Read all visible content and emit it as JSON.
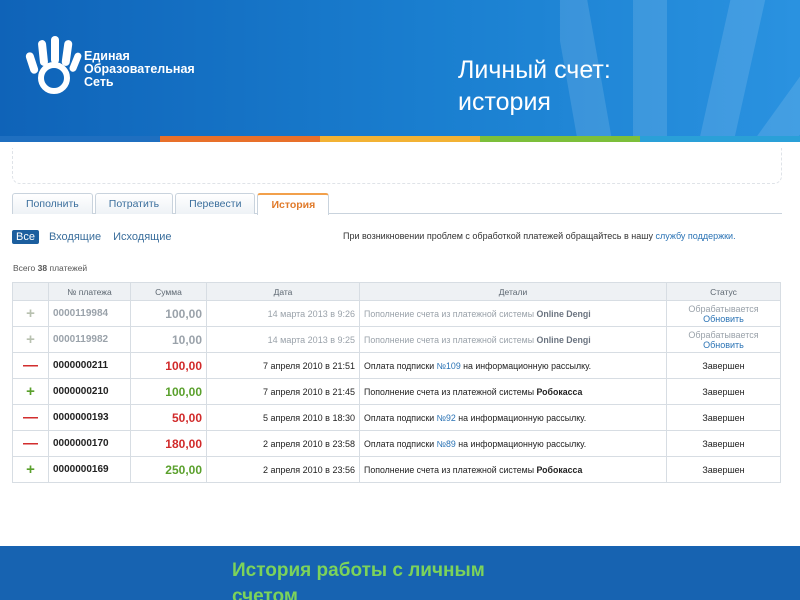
{
  "brand": {
    "line1": "Единая",
    "line2": "Образовательная",
    "line3": "Сеть"
  },
  "slide_title": {
    "line1": "Личный счет:",
    "line2": "история"
  },
  "tabs": [
    {
      "label": "Пополнить",
      "active": false
    },
    {
      "label": "Потратить",
      "active": false
    },
    {
      "label": "Перевести",
      "active": false
    },
    {
      "label": "История",
      "active": true
    }
  ],
  "filters": [
    {
      "label": "Все",
      "active": true
    },
    {
      "label": "Входящие",
      "active": false
    },
    {
      "label": "Исходящие",
      "active": false
    }
  ],
  "notice": {
    "text": "При возникновении проблем с обработкой платежей обращайтесь в нашу ",
    "link": "службу поддержки."
  },
  "total": {
    "prefix": "Всего ",
    "count": "38",
    "suffix": " платежей"
  },
  "table": {
    "headers": [
      "",
      "№ платежа",
      "Сумма",
      "Дата",
      "Детали",
      "Статус"
    ],
    "rows": [
      {
        "sign": "+",
        "type": "plus",
        "pending": true,
        "number": "0000119984",
        "amount": "100,00",
        "date": "14 марта 2013 в 9:26",
        "details_prefix": "Пополнение счета из платежной системы ",
        "details_bold": "Online Dengi",
        "details_link": "",
        "details_suffix": "",
        "status": "Обрабатывается",
        "status_link": "Обновить"
      },
      {
        "sign": "+",
        "type": "plus",
        "pending": true,
        "number": "0000119982",
        "amount": "10,00",
        "date": "14 марта 2013 в 9:25",
        "details_prefix": "Пополнение счета из платежной системы ",
        "details_bold": "Online Dengi",
        "details_link": "",
        "details_suffix": "",
        "status": "Обрабатывается",
        "status_link": "Обновить"
      },
      {
        "sign": "—",
        "type": "minus",
        "pending": false,
        "number": "0000000211",
        "amount": "100,00",
        "date": "7 апреля 2010 в 21:51",
        "details_prefix": "Оплата подписки ",
        "details_bold": "",
        "details_link": "№109",
        "details_suffix": " на информационную рассылку.",
        "status": "Завершен",
        "status_link": ""
      },
      {
        "sign": "+",
        "type": "plus",
        "pending": false,
        "number": "0000000210",
        "amount": "100,00",
        "date": "7 апреля 2010 в 21:45",
        "details_prefix": "Пополнение счета из платежной системы ",
        "details_bold": "Робокасса",
        "details_link": "",
        "details_suffix": "",
        "status": "Завершен",
        "status_link": ""
      },
      {
        "sign": "—",
        "type": "minus",
        "pending": false,
        "number": "0000000193",
        "amount": "50,00",
        "date": "5 апреля 2010 в 18:30",
        "details_prefix": "Оплата подписки ",
        "details_bold": "",
        "details_link": "№92",
        "details_suffix": " на информационную рассылку.",
        "status": "Завершен",
        "status_link": ""
      },
      {
        "sign": "—",
        "type": "minus",
        "pending": false,
        "number": "0000000170",
        "amount": "180,00",
        "date": "2 апреля 2010 в 23:58",
        "details_prefix": "Оплата подписки ",
        "details_bold": "",
        "details_link": "№89",
        "details_suffix": " на информационную рассылку.",
        "status": "Завершен",
        "status_link": ""
      },
      {
        "sign": "+",
        "type": "plus",
        "pending": false,
        "number": "0000000169",
        "amount": "250,00",
        "date": "2 апреля 2010 в 23:56",
        "details_prefix": "Пополнение счета из платежной системы ",
        "details_bold": "Робокасса",
        "details_link": "",
        "details_suffix": "",
        "status": "Завершен",
        "status_link": ""
      }
    ]
  },
  "footer": {
    "text": "История работы с личным счетом"
  },
  "colors": {
    "header_blue": "#1a7fd0",
    "footer_green": "#7cd35a",
    "plus": "#5aa02c",
    "minus": "#d12a2a",
    "stripe": [
      "#1f6fc0",
      "#e8702a",
      "#f2b234",
      "#7cbf3a",
      "#2aa0d8"
    ]
  },
  "icons": {
    "logo": "hand-logo-icon"
  }
}
